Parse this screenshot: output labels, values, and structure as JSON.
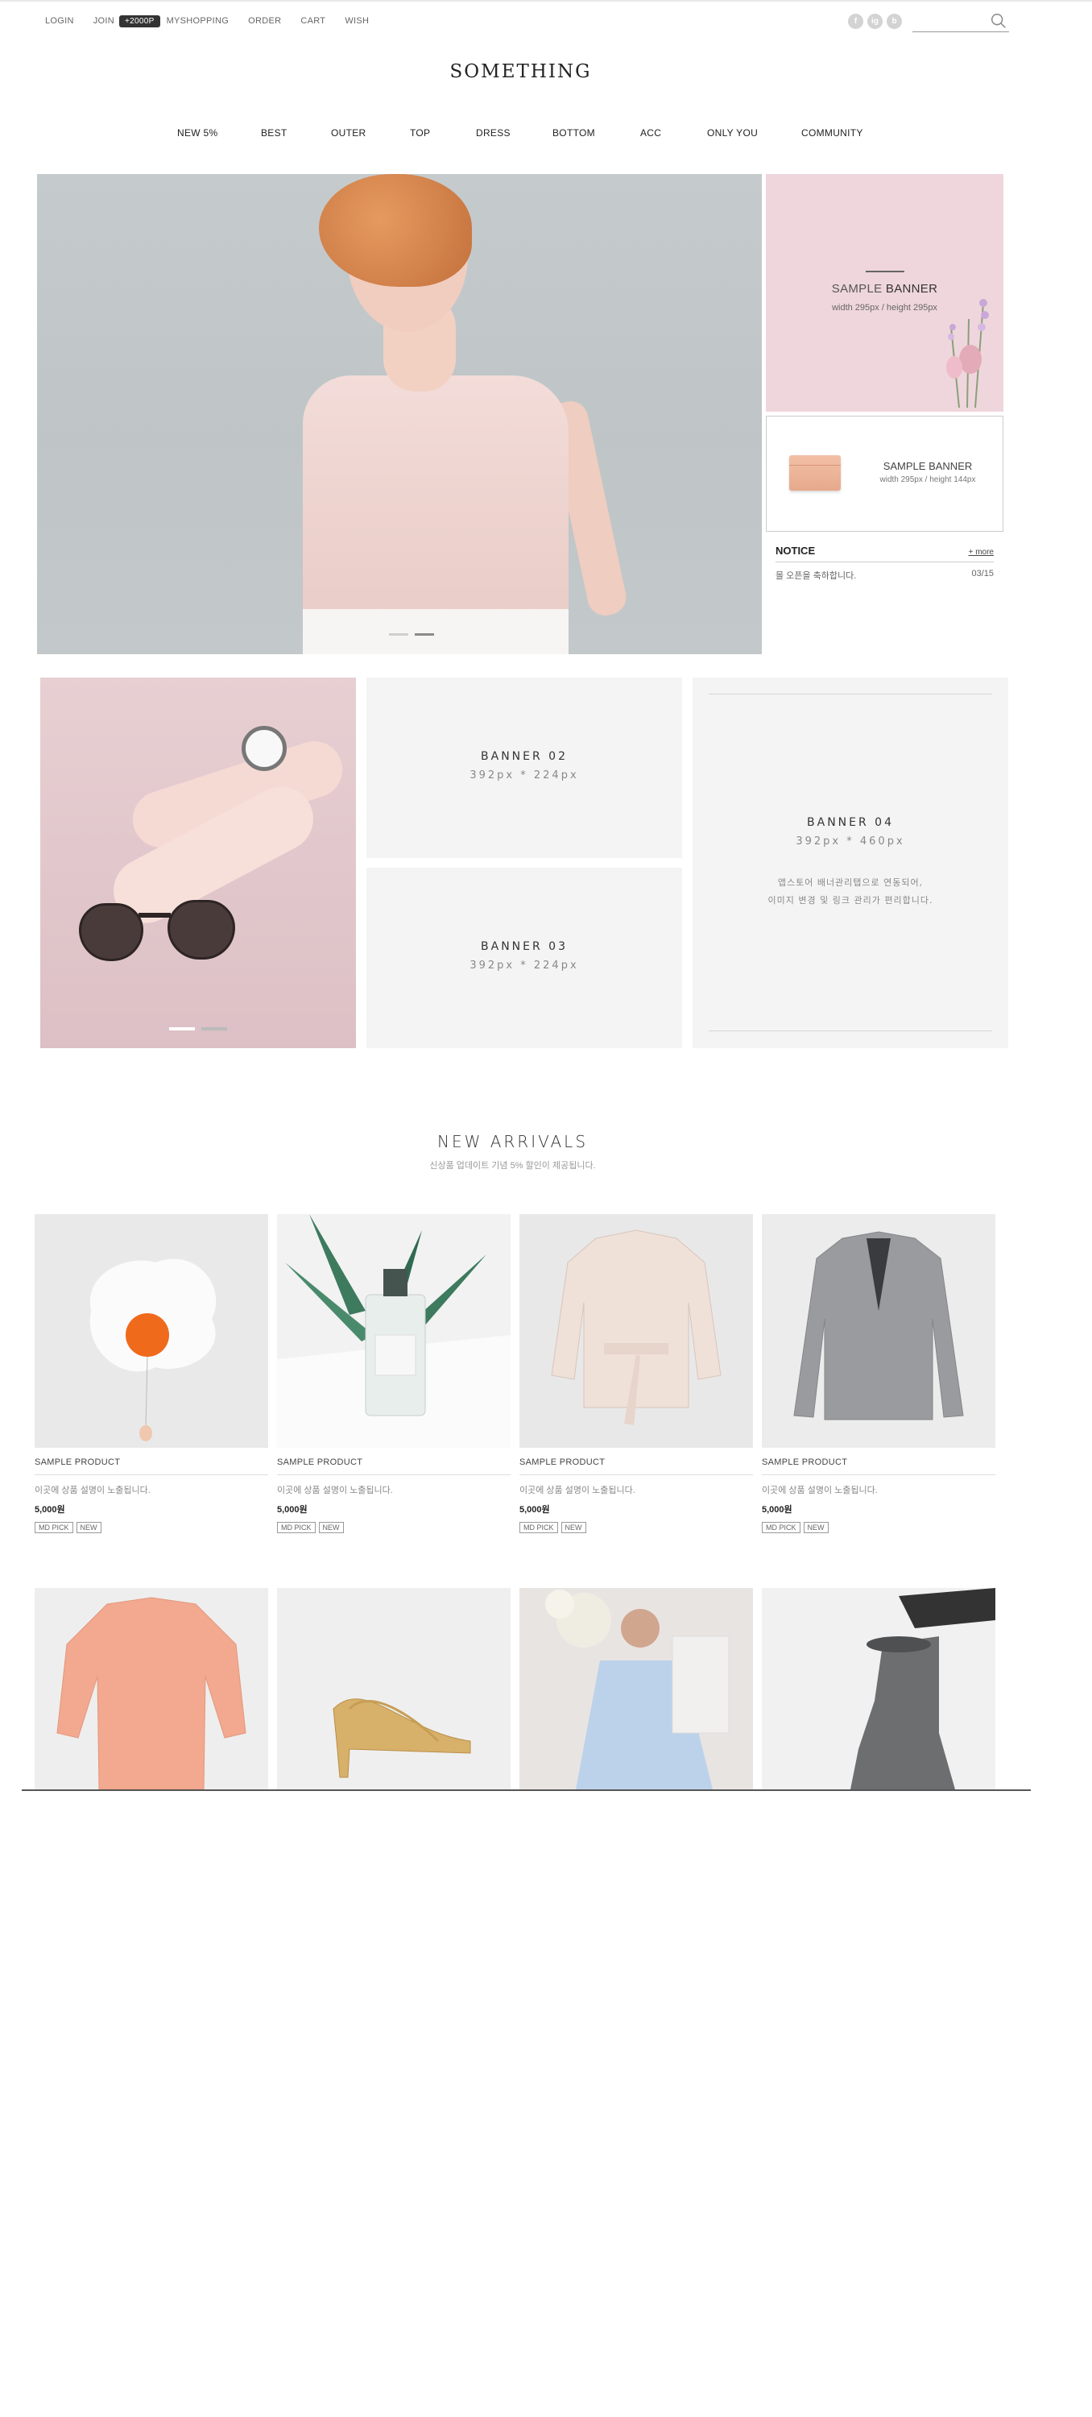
{
  "util": {
    "login": "LOGIN",
    "join": "JOIN",
    "point": "+2000P",
    "myshopping": "MYSHOPPING",
    "order": "ORDER",
    "cart": "CART",
    "wish": "WISH"
  },
  "sns": [
    "f",
    "ig",
    "b"
  ],
  "search": {
    "placeholder": ""
  },
  "logo": "SOMETHING",
  "gnb": [
    "NEW 5%",
    "BEST",
    "OUTER",
    "TOP",
    "DRESS",
    "BOTTOM",
    "ACC",
    "ONLY YOU",
    "COMMUNITY"
  ],
  "banner_pink": {
    "title_a": "SAMPLE ",
    "title_b": "BANNER",
    "size": "width 295px / height 295px"
  },
  "banner_white": {
    "title": "SAMPLE BANNER",
    "size": "width 295px / height 144px"
  },
  "notice": {
    "title": "NOTICE",
    "more": "+ more",
    "items": [
      {
        "text": "몰 오픈을 축하합니다.",
        "date": "03/15"
      }
    ]
  },
  "banners": {
    "b02": {
      "title": "BANNER 02",
      "size": "392px * 224px"
    },
    "b03": {
      "title": "BANNER 03",
      "size": "392px * 224px"
    },
    "b04": {
      "title": "BANNER 04",
      "size": "392px * 460px",
      "line1": "앱스토어 배너관리탭으로 연동되어,",
      "line2": "이미지 변경 및 링크 관리가 편리합니다."
    }
  },
  "arrivals": {
    "title": "NEW ARRIVALS",
    "subtitle": "신상품 업데이트 기념 5% 할인이 제공됩니다.",
    "products": [
      {
        "name": "SAMPLE PRODUCT",
        "desc": "이곳에 상품 설명이 노출됩니다.",
        "price": "5,000원",
        "badge1": "MD PICK",
        "badge2": "NEW"
      },
      {
        "name": "SAMPLE PRODUCT",
        "desc": "이곳에 상품 설명이 노출됩니다.",
        "price": "5,000원",
        "badge1": "MD PICK",
        "badge2": "NEW"
      },
      {
        "name": "SAMPLE PRODUCT",
        "desc": "이곳에 상품 설명이 노출됩니다.",
        "price": "5,000원",
        "badge1": "MD PICK",
        "badge2": "NEW"
      },
      {
        "name": "SAMPLE PRODUCT",
        "desc": "이곳에 상품 설명이 노출됩니다.",
        "price": "5,000원",
        "badge1": "MD PICK",
        "badge2": "NEW"
      }
    ]
  }
}
